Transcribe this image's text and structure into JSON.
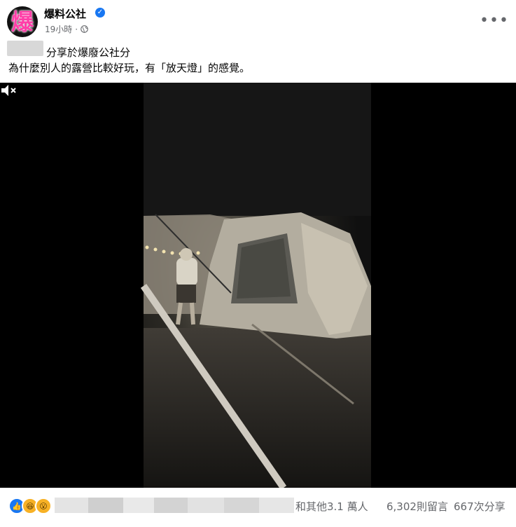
{
  "post": {
    "page_name": "爆料公社",
    "avatar_glyph": "爆",
    "verified_glyph": "✓",
    "time": "19小時",
    "meta_separator": "·",
    "privacy_icon": "globe-icon",
    "more_glyph": "•••",
    "shared_text": "分享於爆廢公社分",
    "caption": "為什麼別人的露營比較好玩，有「放天燈」的感覺。"
  },
  "video": {
    "mute_icon": "volume-muted-icon"
  },
  "footer": {
    "reaction_icons": [
      "like-icon",
      "haha-icon",
      "wow-icon"
    ],
    "reactions_summary": "和其他3.1 萬人",
    "comments": "6,302則留言",
    "shares": "667次分享"
  },
  "colors": {
    "accent": "#1877f2",
    "secondary_text": "#65676b",
    "avatar_glyph": "#ff3fa8"
  }
}
